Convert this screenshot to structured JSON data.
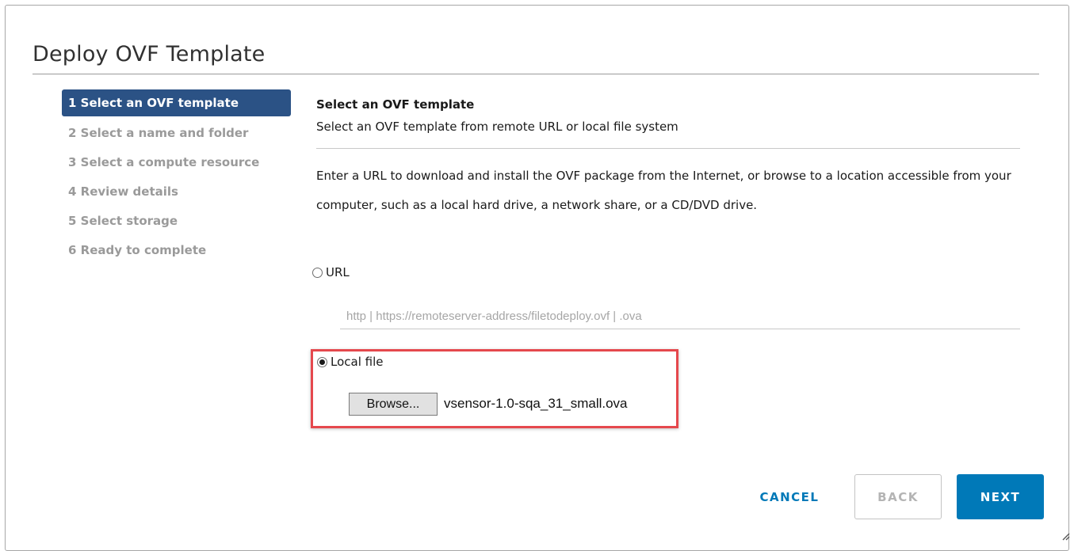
{
  "dialog": {
    "title": "Deploy OVF Template"
  },
  "steps": [
    {
      "label": "1 Select an OVF template",
      "active": true
    },
    {
      "label": "2 Select a name and folder",
      "active": false
    },
    {
      "label": "3 Select a compute resource",
      "active": false
    },
    {
      "label": "4 Review details",
      "active": false
    },
    {
      "label": "5 Select storage",
      "active": false
    },
    {
      "label": "6 Ready to complete",
      "active": false
    }
  ],
  "content": {
    "section_title": "Select an OVF template",
    "section_subtitle": "Select an OVF template from remote URL or local file system",
    "description": "Enter a URL to download and install the OVF package from the Internet, or browse to a location accessible from your computer, such as a local hard drive, a network share, or a CD/DVD drive.",
    "url_option": {
      "label": "URL",
      "selected": false,
      "input_value": "",
      "input_placeholder": "http | https://remoteserver-address/filetodeploy.ovf | .ova"
    },
    "local_option": {
      "label": "Local file",
      "selected": true,
      "browse_label": "Browse...",
      "file_name": "vsensor-1.0-sqa_31_small.ova"
    }
  },
  "footer": {
    "cancel_label": "CANCEL",
    "back_label": "BACK",
    "next_label": "NEXT"
  },
  "colors": {
    "active_step_bg": "#2b5285",
    "primary": "#0079b8",
    "highlight_border": "#e5484d"
  }
}
